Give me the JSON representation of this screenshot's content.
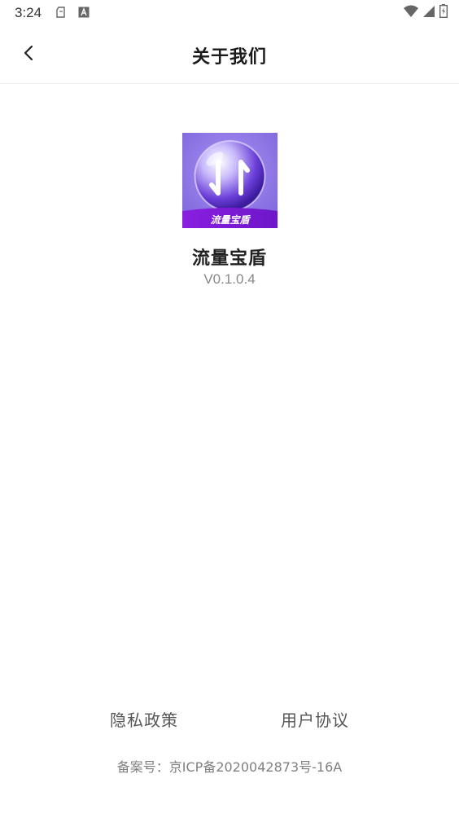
{
  "status_bar": {
    "time": "3:24",
    "left_icons": [
      "sim-card-icon",
      "font-a-icon"
    ],
    "right_icons": [
      "wifi-icon",
      "signal-icon",
      "battery-charging-icon"
    ]
  },
  "header": {
    "title": "关于我们",
    "back_icon": "chevron-left-icon"
  },
  "app": {
    "name": "流量宝盾",
    "version": "V0.1.0.4",
    "logo_text": "流量宝盾",
    "logo_colors": {
      "background": "#8a73e6",
      "banner": "#7b1fd6",
      "sphere": "#b9a8f5"
    }
  },
  "footer": {
    "privacy_label": "隐私政策",
    "terms_label": "用户协议",
    "icp": "备案号：京ICP备2020042873号-16A"
  }
}
